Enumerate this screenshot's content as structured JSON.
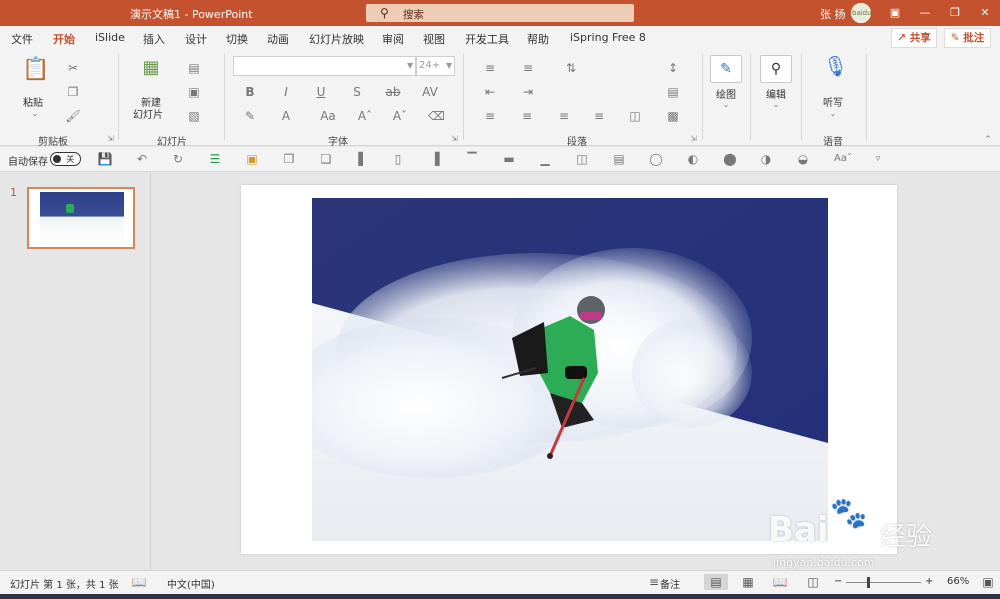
{
  "app": {
    "title": "演示文稿1 - PowerPoint",
    "search_placeholder": "搜索",
    "user_name": "张 扬",
    "avatar_text": "baidu"
  },
  "menu": {
    "tabs": [
      "文件",
      "开始",
      "iSlide",
      "插入",
      "设计",
      "切换",
      "动画",
      "幻灯片放映",
      "审阅",
      "视图",
      "开发工具",
      "帮助",
      "iSpring Free 8"
    ],
    "active": "开始",
    "share": "共享",
    "comment": "批注"
  },
  "ribbon": {
    "clipboard": {
      "paste": "粘贴",
      "label": "剪贴板"
    },
    "slides": {
      "new_slide_line1": "新建",
      "new_slide_line2": "幻灯片",
      "label": "幻灯片"
    },
    "font": {
      "font_name": "",
      "font_size": "24+",
      "label": "字体"
    },
    "paragraph": {
      "label": "段落"
    },
    "drawing": {
      "label": "绘图"
    },
    "editing": {
      "label": "编辑"
    },
    "voice": {
      "dictate": "听写",
      "label": "语音"
    }
  },
  "qat": {
    "autosave_label": "自动保存",
    "autosave_state": "关"
  },
  "thumbnails": {
    "slide_number": "1"
  },
  "status": {
    "slide_info": "幻灯片 第 1 张，共 1 张",
    "language": "中文(中国)",
    "notes": "备注",
    "zoom": "66%",
    "zoom_level": 0.66
  },
  "watermark": {
    "brand": "Bai",
    "suffix": "经验",
    "url": "jingyan.baidu.com"
  },
  "colors": {
    "accent": "#c4522f",
    "sky": "#2c3b86",
    "jacket": "#2cad55"
  }
}
